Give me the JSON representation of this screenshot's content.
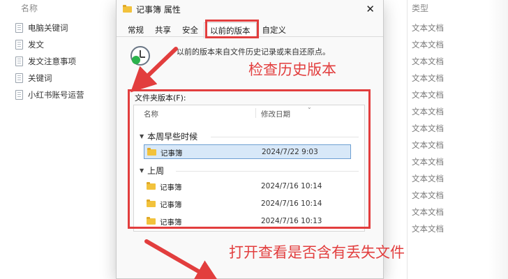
{
  "background": {
    "header_name": "名称",
    "header_type": "类型",
    "files": [
      {
        "name": "电脑关键词",
        "type": "文本文档"
      },
      {
        "name": "发文",
        "type": "文本文档"
      },
      {
        "name": "发文注意事项",
        "type": "文本文档"
      },
      {
        "name": "关键词",
        "type": "文本文档"
      },
      {
        "name": "小红书账号运营",
        "type": "文本文档"
      }
    ],
    "extra_types": [
      "文本文档",
      "文本文档",
      "文本文档",
      "文本文档",
      "文本文档",
      "文本文档",
      "文本文档",
      "文本文档"
    ]
  },
  "dialog": {
    "title": "记事簿 属性",
    "close_label": "✕",
    "tabs": [
      "常规",
      "共享",
      "安全",
      "以前的版本",
      "自定义"
    ],
    "active_tab": "以前的版本",
    "info_text": "以前的版本来自文件历史记录或来自还原点。",
    "folder_versions_label": "文件夹版本(F):",
    "columns": {
      "name": "名称",
      "date": "修改日期"
    },
    "groups": [
      {
        "label": "本周早些时候",
        "rows": [
          {
            "name": "记事簿",
            "date": "2024/7/22 9:03",
            "selected": true
          }
        ]
      },
      {
        "label": "上周",
        "rows": [
          {
            "name": "记事簿",
            "date": "2024/7/16 10:14",
            "selected": false
          },
          {
            "name": "记事簿",
            "date": "2024/7/16 10:14",
            "selected": false
          },
          {
            "name": "记事簿",
            "date": "2024/7/16 10:13",
            "selected": false
          }
        ]
      }
    ]
  },
  "annotations": {
    "callout_1": "检查历史版本",
    "callout_2": "打开查看是否含有丢失文件",
    "color": "#e23e3e"
  },
  "colors": {
    "selection_bg": "#d8e8f8",
    "folder": "#f2c23c",
    "accent_red": "#e23e3e"
  }
}
